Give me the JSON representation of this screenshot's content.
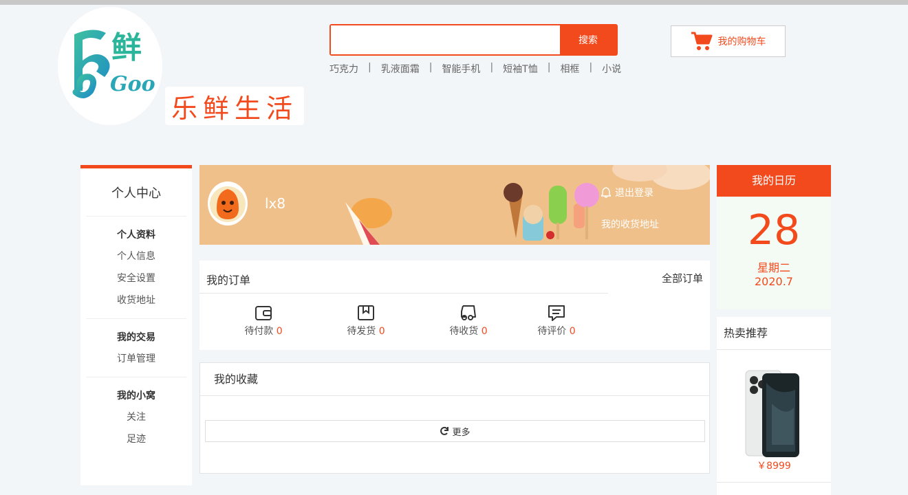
{
  "header": {
    "logo_text": "乐鲜 Goo",
    "brand_name": "乐鲜生活",
    "search": {
      "value": "",
      "placeholder": "",
      "button_label": "搜索"
    },
    "hot_words": [
      "巧克力",
      "乳液面霜",
      "智能手机",
      "短袖T恤",
      "相框",
      "小说"
    ],
    "separator": "|",
    "cart_label": "我的购物车"
  },
  "sidebar": {
    "title": "个人中心",
    "groups": [
      {
        "head": "个人资料",
        "items": [
          "个人信息",
          "安全设置",
          "收货地址"
        ]
      },
      {
        "head": "我的交易",
        "items": [
          "订单管理"
        ]
      },
      {
        "head": "我的小窝",
        "items": [
          "关注",
          "足迹"
        ]
      }
    ]
  },
  "profile": {
    "username": "lx8",
    "logout_label": "退出登录",
    "address_label": "我的收货地址"
  },
  "orders": {
    "title": "我的订单",
    "all_label": "全部订单",
    "items": [
      {
        "label": "待付款",
        "count": "0",
        "icon": "wallet-icon"
      },
      {
        "label": "待发货",
        "count": "0",
        "icon": "package-icon"
      },
      {
        "label": "待收货",
        "count": "0",
        "icon": "truck-icon"
      },
      {
        "label": "待评价",
        "count": "0",
        "icon": "comment-icon"
      }
    ]
  },
  "favorites": {
    "title": "我的收藏",
    "more_label": "更多"
  },
  "calendar": {
    "title": "我的日历",
    "day": "28",
    "weekday": "星期二",
    "year_month": "2020.7"
  },
  "hot": {
    "title": "热卖推荐",
    "price": "￥8999"
  },
  "colors": {
    "accent": "#f24a1d",
    "banner": "#f0c08a",
    "logo_green": "#2bb59a"
  }
}
